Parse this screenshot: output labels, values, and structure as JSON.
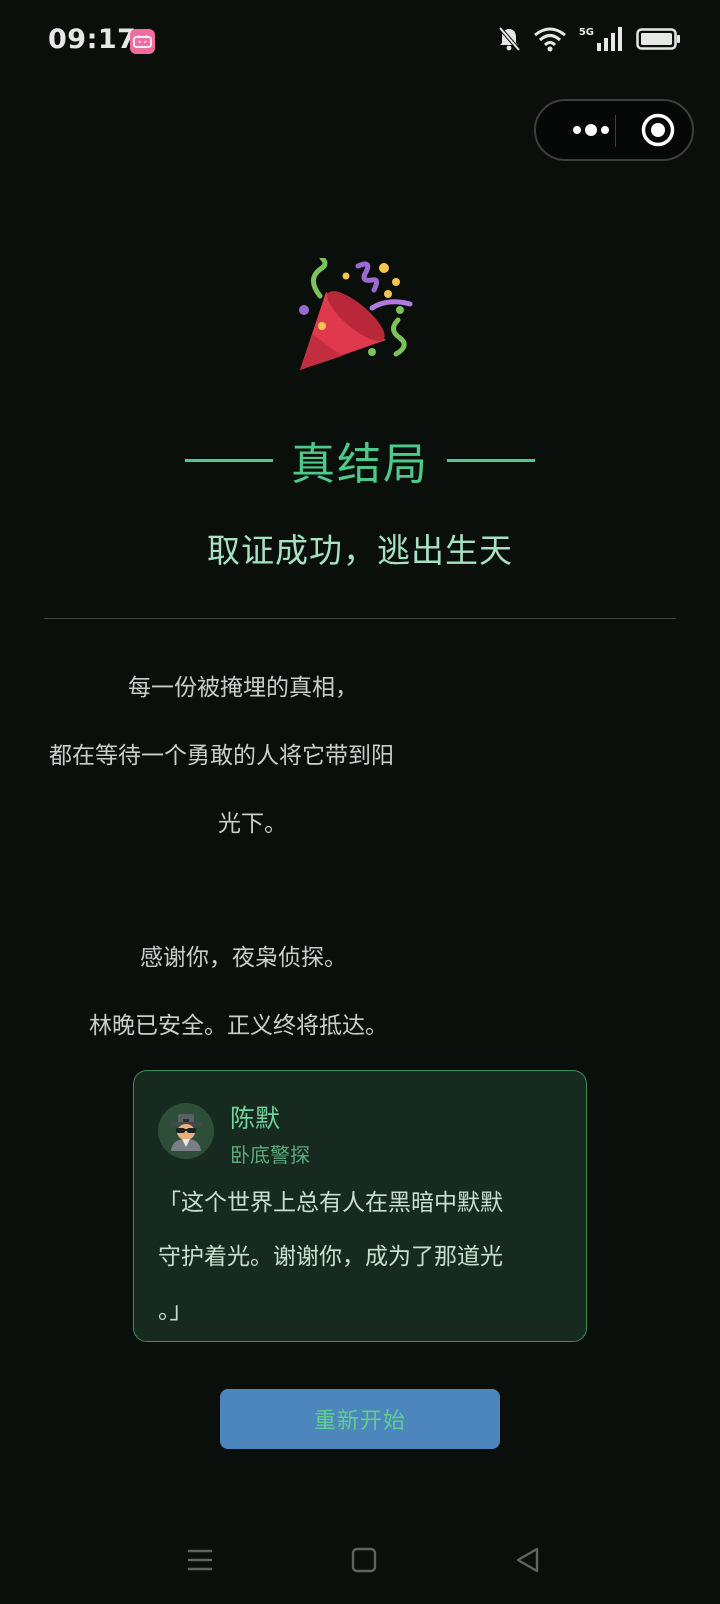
{
  "status_bar": {
    "time": "09:17",
    "app_badge": "bilibili",
    "network_label": "5G",
    "icons": [
      "mute-bell-icon",
      "wifi-icon",
      "signal-icon",
      "battery-icon"
    ]
  },
  "capsule": {
    "icons": [
      "more-icon",
      "target-icon"
    ]
  },
  "ending": {
    "icon": "party-popper-icon",
    "title": "真结局",
    "subtitle": "取证成功，逃出生天",
    "paragraph1": [
      "每一份被掩埋的真相，",
      "都在等待一个勇敢的人将它带到阳",
      "光下。"
    ],
    "paragraph2": [
      "感谢你，夜枭侦探。",
      "林晚已安全。正义终将抵达。"
    ]
  },
  "character_card": {
    "avatar_icon": "detective-icon",
    "name": "陈默",
    "role": "卧底警探",
    "quote_lines": [
      "「这个世界上总有人在黑暗中默默",
      "守护着光。谢谢你，成为了那道光",
      "。」"
    ]
  },
  "restart_button": {
    "label": "重新开始"
  },
  "nav_bar": {
    "icons": [
      "menu-icon",
      "home-icon",
      "back-icon"
    ]
  },
  "colors": {
    "background": "#0a0f0c",
    "accent_green": "#4fc98a",
    "card_bg": "#162a1f",
    "button_blue": "#4d85bd"
  }
}
